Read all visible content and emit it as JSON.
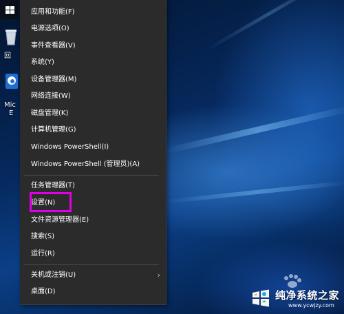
{
  "menu": {
    "items": [
      {
        "label": "应用和功能(F)"
      },
      {
        "label": "电源选项(O)"
      },
      {
        "label": "事件查看器(V)"
      },
      {
        "label": "系统(Y)"
      },
      {
        "label": "设备管理器(M)"
      },
      {
        "label": "网络连接(W)"
      },
      {
        "label": "磁盘管理(K)"
      },
      {
        "label": "计算机管理(G)"
      },
      {
        "label": "Windows PowerShell(I)"
      },
      {
        "label": "Windows PowerShell (管理员)(A)"
      },
      {
        "label": "任务管理器(T)"
      },
      {
        "label": "设置(N)"
      },
      {
        "label": "文件资源管理器(E)"
      },
      {
        "label": "搜索(S)"
      },
      {
        "label": "运行(R)"
      },
      {
        "label": "关机或注销(U)",
        "has_submenu": true
      },
      {
        "label": "桌面(D)"
      }
    ],
    "highlighted_item": "设置(N)",
    "highlight_color": "#e000e8"
  },
  "desktop": {
    "icon_labels": [
      "回",
      "Mic",
      "E"
    ]
  },
  "watermark": {
    "title": "纯净系统之家",
    "url": "www.ycwjzy.com"
  }
}
